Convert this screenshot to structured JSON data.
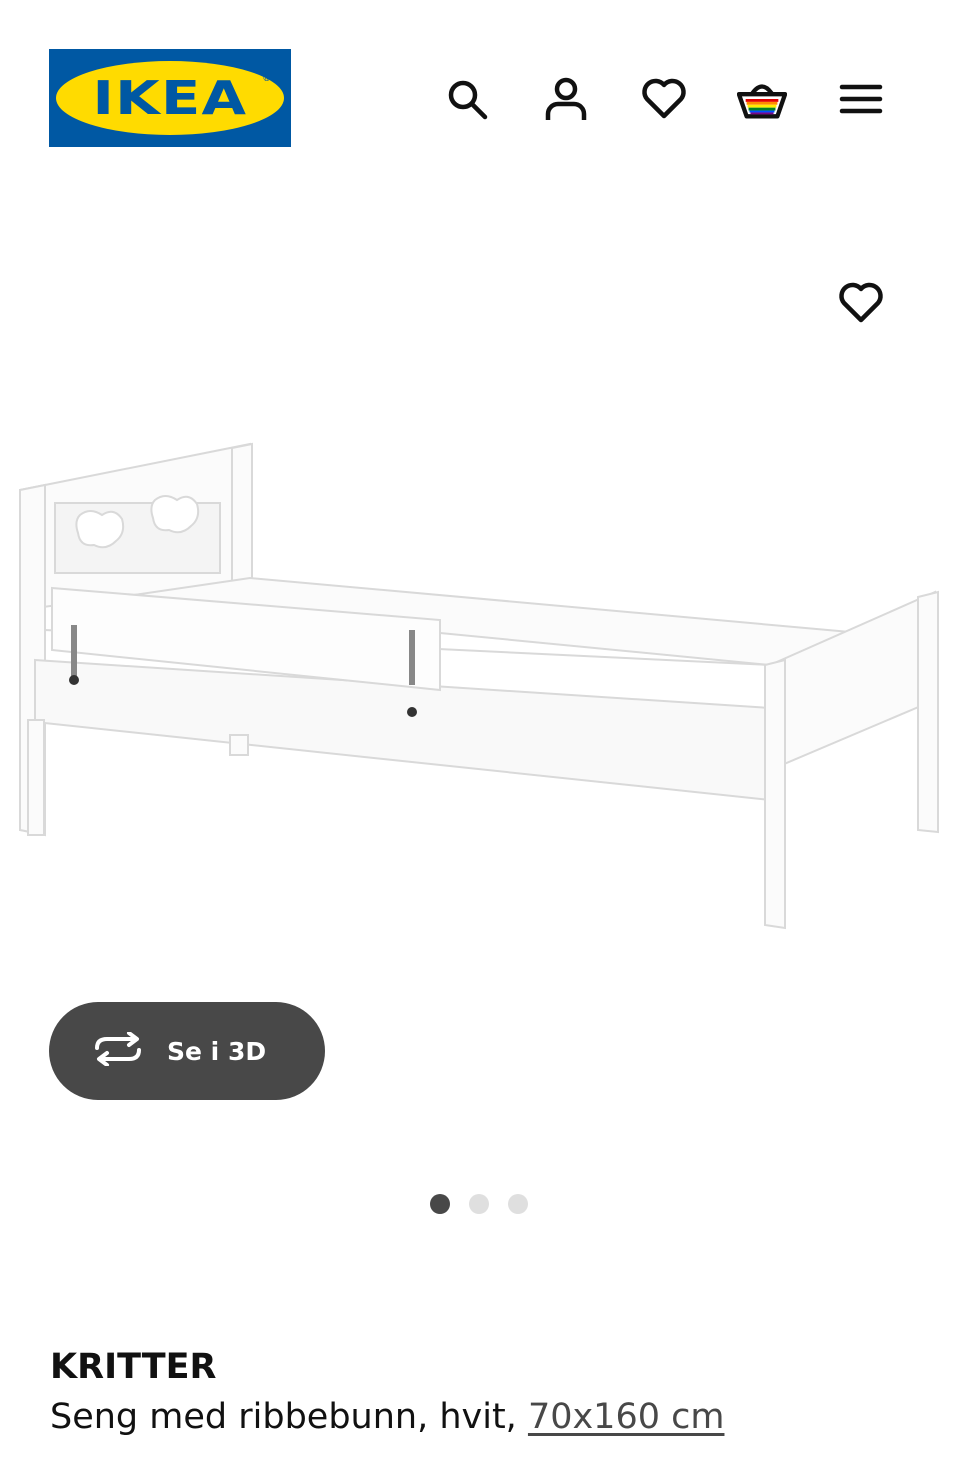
{
  "header": {
    "logo_text": "IKEA",
    "logo_reg": "®",
    "icons": [
      "search-icon",
      "account-icon",
      "heart-icon",
      "basket-icon",
      "menu-icon"
    ]
  },
  "gallery": {
    "view_3d_label": "Se i 3D",
    "slide_count": 3,
    "active_slide": 1
  },
  "product": {
    "name": "KRITTER",
    "description": "Seng med ribbebunn, hvit, ",
    "size": "70x160 cm"
  },
  "colors": {
    "brand_blue": "#0058a3",
    "brand_yellow": "#ffdb00",
    "button_dark": "#484848",
    "dot_inactive": "#dfdfdf"
  }
}
